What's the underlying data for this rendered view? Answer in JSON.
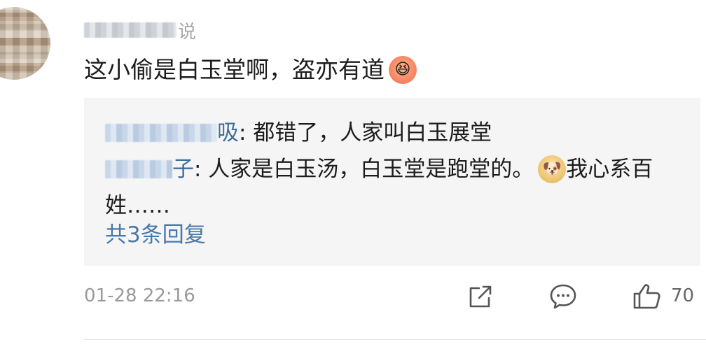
{
  "post": {
    "author_tail": "说",
    "text": "这小偷是白玉堂啊，盗亦有道",
    "text_emoji": "laugh-emoji"
  },
  "replies": [
    {
      "author_tail": "吸",
      "text": ": 都错了，人家叫白玉展堂"
    },
    {
      "author_tail": "子",
      "text_1": ": 人家是白玉汤，白玉堂是跑堂的。",
      "emoji": "doge-emoji",
      "text_2": "我心系百",
      "text_3": "姓……"
    }
  ],
  "more_replies_label": "共3条回复",
  "meta": {
    "timestamp": "01-28 22:16",
    "like_count": "70"
  },
  "icons": {
    "share": "share-icon",
    "comment": "comment-icon",
    "like": "thumbs-up-icon"
  }
}
